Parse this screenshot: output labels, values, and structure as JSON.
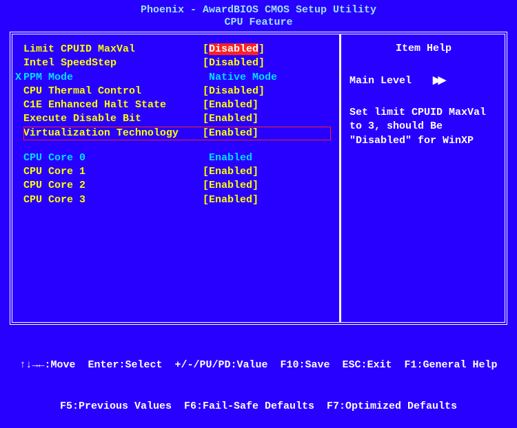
{
  "header": {
    "line1": "Phoenix - AwardBIOS CMOS Setup Utility",
    "line2": "CPU Feature"
  },
  "settings": {
    "rows": [
      {
        "label": "Limit CPUID MaxVal",
        "value": "Disabled",
        "bracket": true,
        "label_class": "yellow",
        "value_class": "redsel",
        "marker": ""
      },
      {
        "label": "Intel SpeedStep",
        "value": "Disabled",
        "bracket": true,
        "label_class": "yellow",
        "value_class": "yellow",
        "marker": ""
      },
      {
        "label": "PPM Mode",
        "value": "Native Mode",
        "bracket": false,
        "label_class": "cyan",
        "value_class": "cyan",
        "marker": "X"
      },
      {
        "label": "CPU Thermal Control",
        "value": "Disabled",
        "bracket": true,
        "label_class": "yellow",
        "value_class": "yellow",
        "marker": ""
      },
      {
        "label": "C1E Enhanced Halt State",
        "value": "Enabled",
        "bracket": true,
        "label_class": "yellow",
        "value_class": "yellow",
        "marker": ""
      },
      {
        "label": "Execute Disable Bit",
        "value": "Enabled",
        "bracket": true,
        "label_class": "yellow",
        "value_class": "yellow",
        "marker": ""
      },
      {
        "label": "Virtualization Technology",
        "value": "Enabled",
        "bracket": true,
        "label_class": "yellow",
        "value_class": "yellow",
        "marker": "",
        "row_outline": true
      }
    ],
    "cores": [
      {
        "label": "CPU Core 0",
        "value": "Enabled",
        "bracket": false,
        "label_class": "cyan",
        "value_class": "cyan"
      },
      {
        "label": "CPU Core 1",
        "value": "Enabled",
        "bracket": true,
        "label_class": "yellow",
        "value_class": "yellow"
      },
      {
        "label": "CPU Core 2",
        "value": "Enabled",
        "bracket": true,
        "label_class": "yellow",
        "value_class": "yellow"
      },
      {
        "label": "CPU Core 3",
        "value": "Enabled",
        "bracket": true,
        "label_class": "yellow",
        "value_class": "yellow"
      }
    ]
  },
  "help": {
    "title": "Item Help",
    "main_level": "Main Level",
    "text": "Set limit CPUID MaxVal to 3, should Be \"Disabled\" for WinXP"
  },
  "footer": {
    "line1": "↑↓→←:Move  Enter:Select  +/-/PU/PD:Value  F10:Save  ESC:Exit  F1:General Help",
    "line2": "F5:Previous Values  F6:Fail-Safe Defaults  F7:Optimized Defaults"
  }
}
